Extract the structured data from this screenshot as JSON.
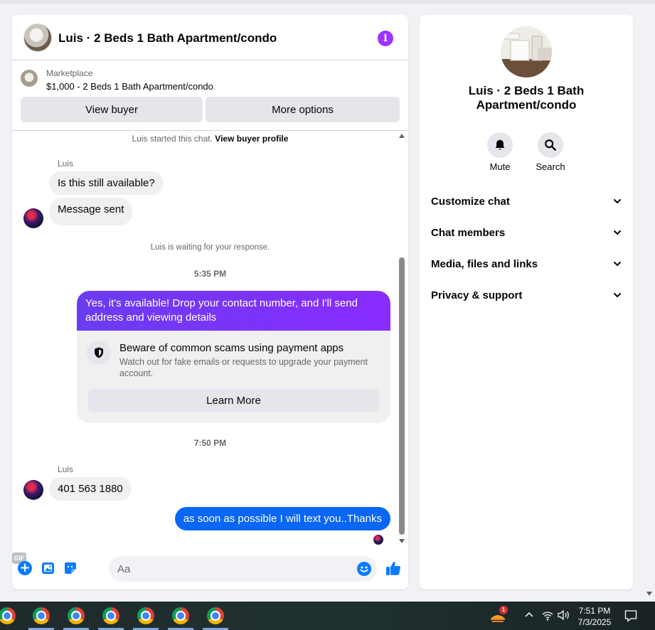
{
  "header": {
    "title": "Luis · 2 Beds 1 Bath Apartment/condo"
  },
  "marketplace": {
    "label": "Marketplace",
    "listing": "$1,000 - 2 Beds 1 Bath Apartment/condo",
    "view_buyer": "View buyer",
    "more_options": "More options"
  },
  "messages": {
    "started_prefix": "Luis started this chat.",
    "started_link": "View buyer profile",
    "sender_1": "Luis",
    "msg_1": "Is this still available?",
    "msg_2": "Message sent",
    "waiting": "Luis is waiting for your response.",
    "time_1": "5:35 PM",
    "out_1": "Yes, it's available! Drop your contact number, and I'll send address and viewing details",
    "scam_title": "Beware of common scams using payment apps",
    "scam_sub": "Watch out for fake emails or requests to upgrade your payment account.",
    "learn_more": "Learn More",
    "time_2": "7:50 PM",
    "sender_2": "Luis",
    "msg_3": "401 563 1880",
    "out_2": "as soon as possible I will text you..Thanks"
  },
  "composer": {
    "placeholder": "Aa",
    "gif_label": "GIF"
  },
  "side": {
    "title": "Luis · 2 Beds 1 Bath Apartment/condo",
    "mute_label": "Mute",
    "search_label": "Search",
    "sections": [
      "Customize chat",
      "Chat members",
      "Media, files and links",
      "Privacy & support"
    ]
  },
  "taskbar": {
    "badge": "1",
    "time": "7:51 PM",
    "date": "7/3/2025"
  },
  "icons": {
    "info": "info-icon",
    "bell": "bell-icon",
    "search": "search-icon",
    "chevron": "chevron-down-icon",
    "shield": "shield-icon",
    "plus": "plus-icon",
    "photo": "photo-icon",
    "sticker": "sticker-icon",
    "gif": "gif-icon",
    "emoji": "emoji-icon",
    "like": "thumbs-up-icon"
  },
  "colors": {
    "accent_purple": "#a033ff",
    "outgoing_purple": "#7e2ff5",
    "outgoing_blue": "#0a66f5",
    "messenger_blue": "#0a7cff"
  }
}
